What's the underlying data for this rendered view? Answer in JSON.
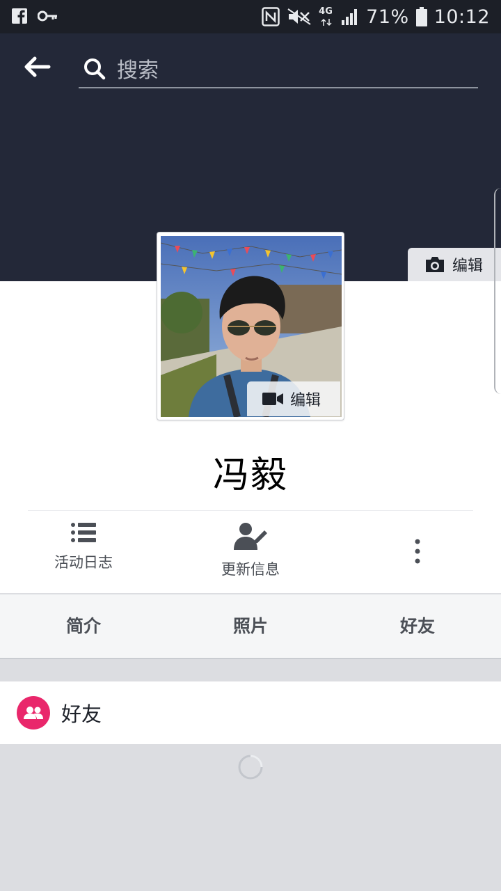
{
  "status_bar": {
    "battery": "71%",
    "time": "10:12",
    "network": "4G",
    "icons": [
      "facebook-icon",
      "key-icon",
      "nfc-icon",
      "mute-icon",
      "signal-icon",
      "battery-icon"
    ]
  },
  "header": {
    "search_placeholder": "搜索",
    "cover_edit_label": "编辑"
  },
  "profile": {
    "name": "冯毅",
    "avatar_edit_label": "编辑"
  },
  "actions": [
    {
      "label": "活动日志",
      "icon": "list-icon"
    },
    {
      "label": "更新信息",
      "icon": "edit-profile-icon"
    },
    {
      "label": "",
      "icon": "more-icon"
    }
  ],
  "tabs": [
    "简介",
    "照片",
    "好友"
  ],
  "friends_section": {
    "label": "好友",
    "icon": "friends-icon"
  },
  "colors": {
    "status_bar": "#1c1f27",
    "cover": "#232838",
    "friends_badge": "#e9276b",
    "tabs_bg": "#f5f6f7",
    "page_bg": "#dcdde1"
  }
}
